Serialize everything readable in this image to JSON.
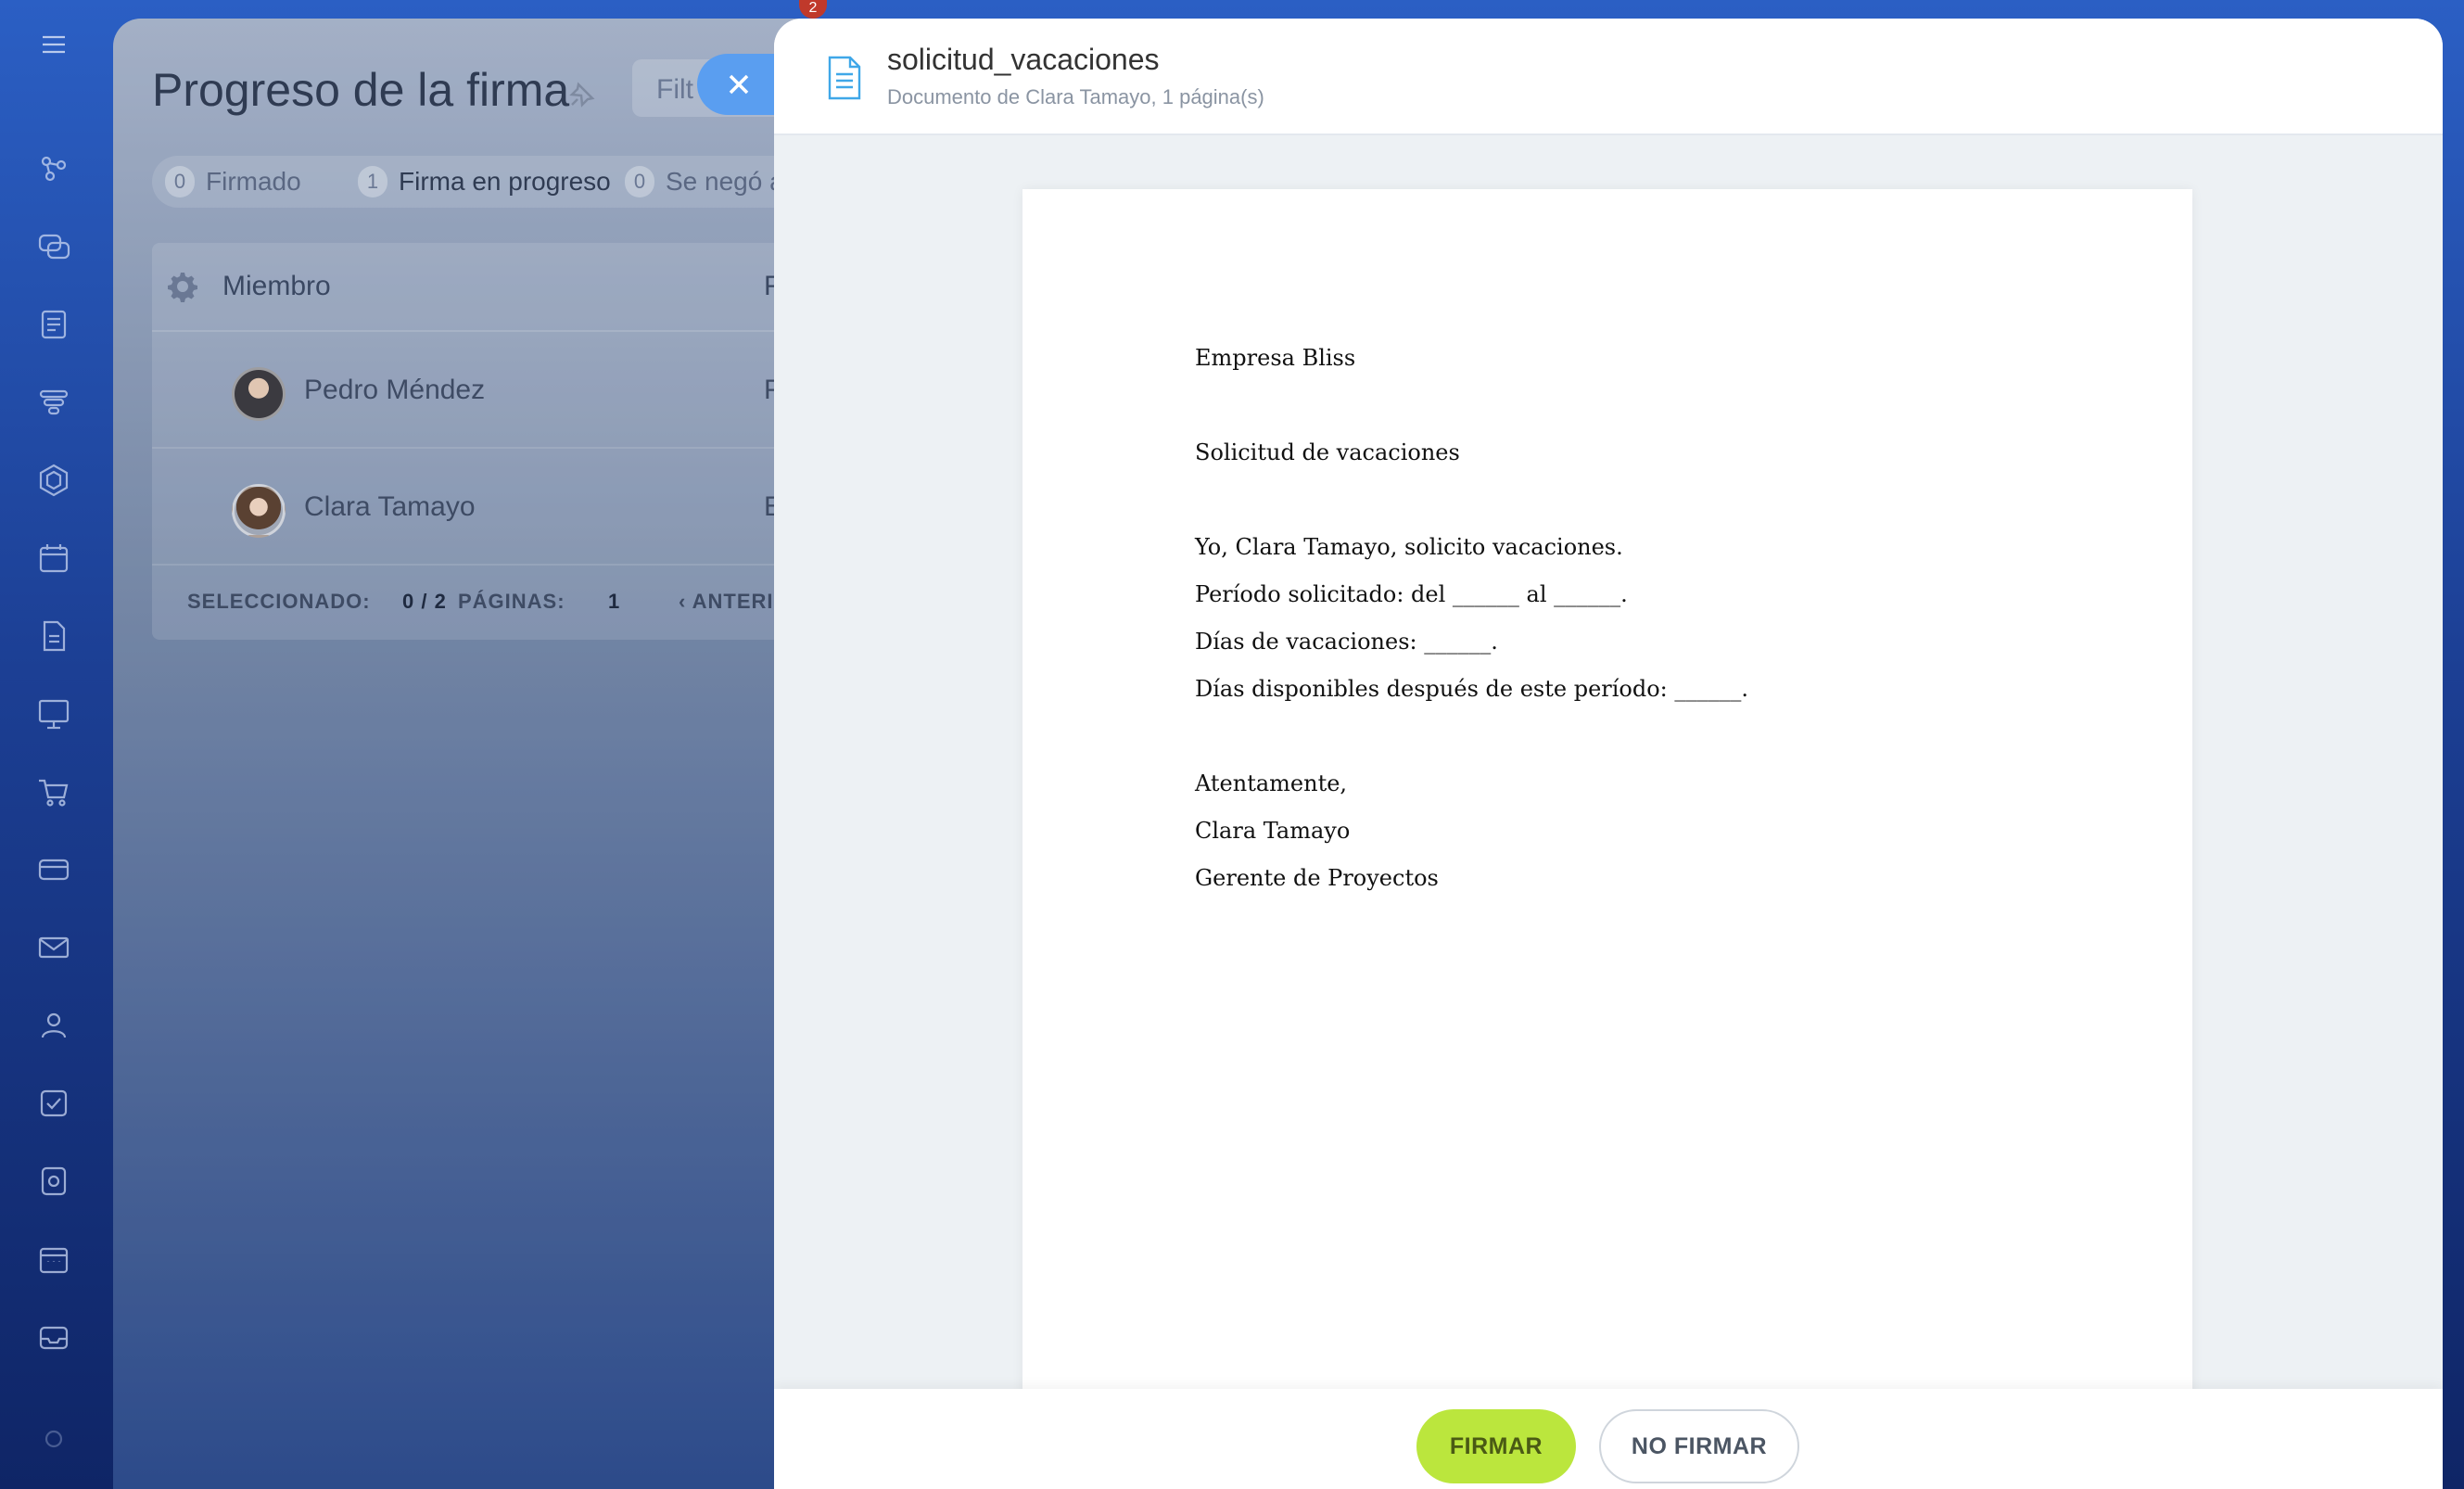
{
  "rail": {
    "icons": [
      "menu-icon",
      "graph-icon",
      "chat-icon",
      "feed-icon",
      "funnel-icon",
      "hexagon-icon",
      "calendar-icon",
      "document-icon",
      "presentation-icon",
      "cart-icon",
      "card-icon",
      "mail-icon",
      "users-icon",
      "checkbox-icon",
      "settings-box-icon",
      "calendar-grid-icon",
      "inbox-icon",
      "gear-icon"
    ],
    "notification_count": "2"
  },
  "background": {
    "title": "Progreso de la firma",
    "filter_placeholder": "Filt",
    "status": [
      {
        "count": "0",
        "label": "Firmado"
      },
      {
        "count": "1",
        "label": "Firma en progreso"
      },
      {
        "count": "0",
        "label": "Se negó a"
      }
    ],
    "table": {
      "header_member": "Miembro",
      "header_trunc": "F",
      "rows": [
        {
          "name": "Pedro Méndez",
          "trunc": "F"
        },
        {
          "name": "Clara Tamayo",
          "trunc": "E"
        }
      ],
      "footer": {
        "selected_label": "SELECCIONADO:",
        "selected_value": "0 / 2",
        "pages_label": "PÁGINAS:",
        "pages_value": "1",
        "prev": "ANTERIOR"
      }
    }
  },
  "viewer": {
    "title": "solicitud_vacaciones",
    "subtitle": "Documento de Clara Tamayo, 1 página(s)",
    "document_lines": [
      "Empresa Bliss",
      "Solicitud de vacaciones",
      "Yo, Clara Tamayo, solicito vacaciones.",
      "Período solicitado: del ______ al ______.",
      "Días de vacaciones: ______.",
      "Días disponibles después de este período: ______.",
      "Atentamente,",
      "Clara Tamayo",
      "Gerente de Proyectos"
    ],
    "sign_button": "FIRMAR",
    "no_sign_button": "NO FIRMAR"
  },
  "colors": {
    "accent_sign": "#bbe63d",
    "close_button": "#5a9ef0",
    "doc_icon": "#3fa7e8"
  }
}
